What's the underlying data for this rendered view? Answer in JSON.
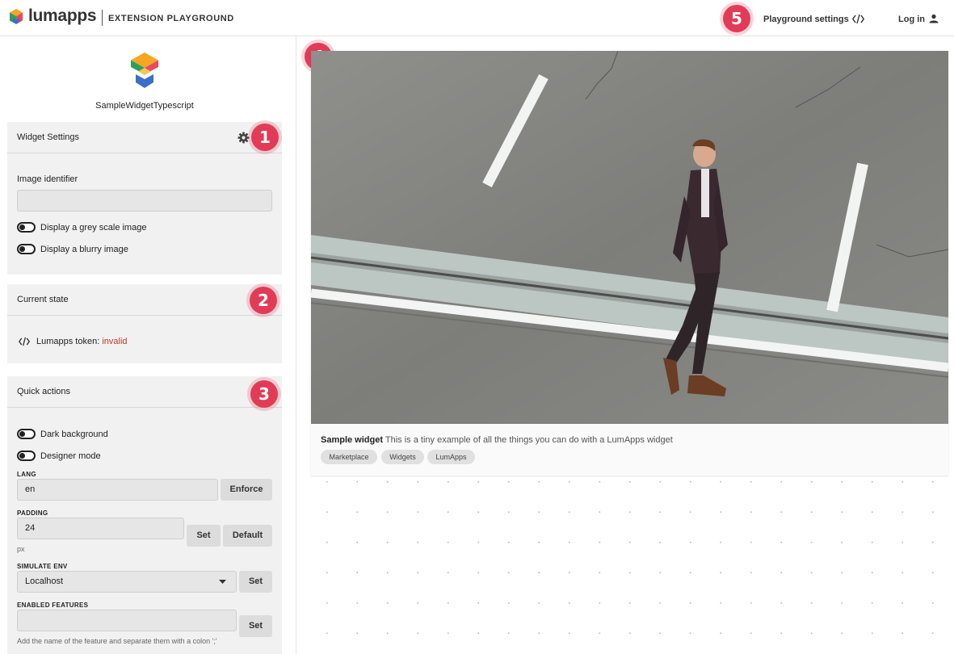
{
  "header": {
    "brand": "lumapps",
    "subtitle": "EXTENSION PLAYGROUND",
    "playground_settings": "Playground settings",
    "login": "Log in"
  },
  "sidebar": {
    "widget_name": "SampleWidgetTypescript",
    "widget_settings": {
      "title": "Widget Settings",
      "image_identifier_label": "Image identifier",
      "image_identifier_value": "",
      "toggle_grey": "Display a grey scale image",
      "toggle_blurry": "Display a blurry image"
    },
    "current_state": {
      "title": "Current state",
      "token_label": "Lumapps token:",
      "token_value": "invalid"
    },
    "quick_actions": {
      "title": "Quick actions",
      "toggle_dark": "Dark background",
      "toggle_designer": "Designer mode",
      "lang_label": "LANG",
      "lang_value": "en",
      "enforce_btn": "Enforce",
      "padding_label": "PADDING",
      "padding_value": "24",
      "padding_unit": "px",
      "set_btn": "Set",
      "default_btn": "Default",
      "simulate_env_label": "SIMULATE ENV",
      "simulate_env_value": "Localhost",
      "enabled_features_label": "ENABLED FEATURES",
      "enabled_features_value": "",
      "enabled_features_hint": "Add the name of the feature and separate them with a colon ';'"
    }
  },
  "badges": [
    "1",
    "2",
    "3",
    "4",
    "5"
  ],
  "widget": {
    "title": "Sample widget",
    "description": "This is a tiny example of all the things you can do with a LumApps widget",
    "tags": [
      "Marketplace",
      "Widgets",
      "LumApps"
    ]
  },
  "colors": {
    "badge": "#e23b57",
    "token_invalid": "#c0392b",
    "panel_bg": "#f1f1f1"
  }
}
